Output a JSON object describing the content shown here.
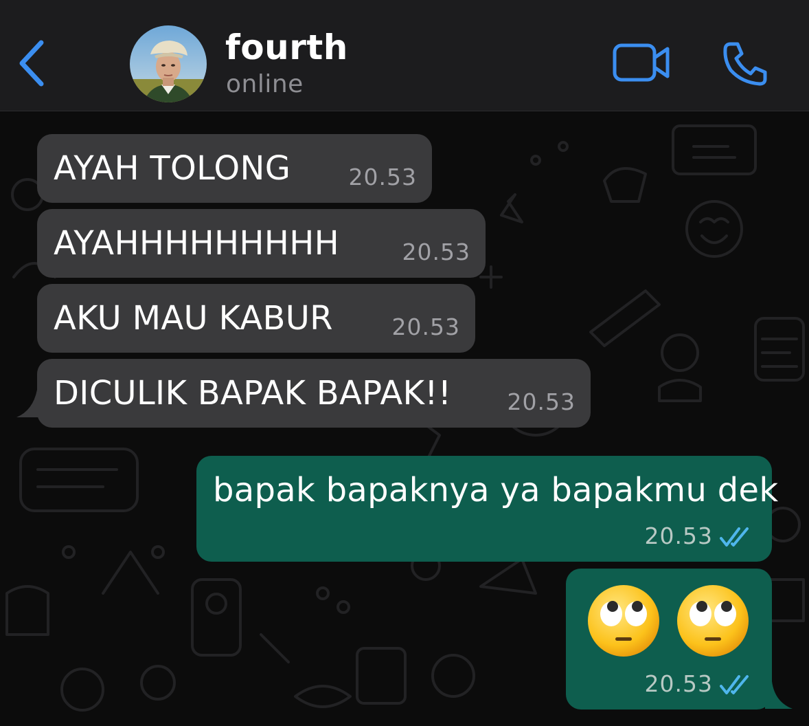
{
  "header": {
    "contact_name": "fourth",
    "status": "online",
    "icons": {
      "back": "chevron-left-icon",
      "video": "video-camera-icon",
      "call": "phone-icon"
    },
    "accent_color": "#3b8ef0"
  },
  "messages": [
    {
      "direction": "incoming",
      "text": "AYAH TOLONG",
      "time": "20.53"
    },
    {
      "direction": "incoming",
      "text": "AYAHHHHHHHHH",
      "time": "20.53"
    },
    {
      "direction": "incoming",
      "text": "AKU MAU KABUR",
      "time": "20.53"
    },
    {
      "direction": "incoming",
      "text": "DICULIK BAPAK BAPAK!!",
      "time": "20.53"
    },
    {
      "direction": "outgoing",
      "text": "bapak bapaknya ya bapakmu dek",
      "time": "20.53",
      "status": "read"
    },
    {
      "direction": "outgoing",
      "text": "🙄 🙄",
      "emoji": [
        "face-with-rolling-eyes",
        "face-with-rolling-eyes"
      ],
      "time": "20.53",
      "status": "read"
    }
  ],
  "colors": {
    "incoming_bubble": "#3a3a3c",
    "outgoing_bubble": "#0e5e4e",
    "read_ticks": "#4fb6ec"
  }
}
